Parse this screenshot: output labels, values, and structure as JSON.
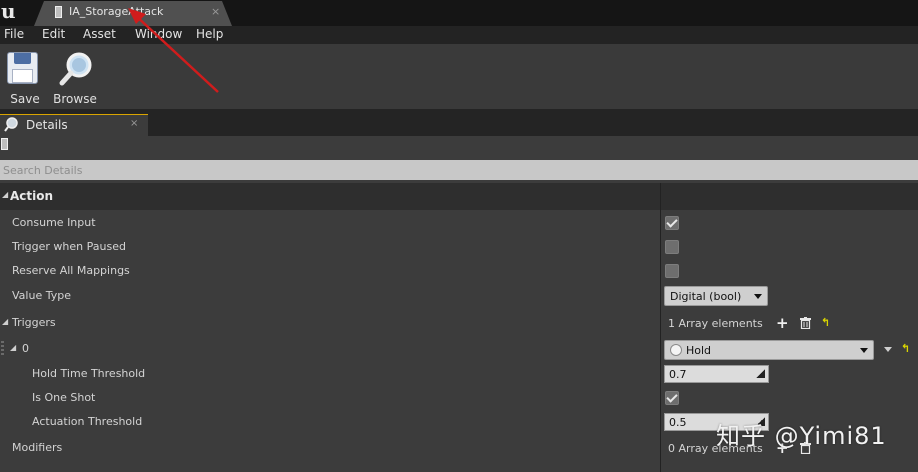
{
  "window": {
    "tab_title": "IA_StorageAttack",
    "tab_close": "×"
  },
  "menu": {
    "items": [
      "File",
      "Edit",
      "Asset",
      "Window",
      "Help"
    ]
  },
  "toolbar": {
    "save_label": "Save",
    "browse_label": "Browse"
  },
  "details_panel": {
    "tab_label": "Details",
    "tab_close": "×",
    "search_placeholder": "Search Details",
    "category": "Action",
    "properties": {
      "consume_input": {
        "label": "Consume Input",
        "checked": true
      },
      "trigger_when_paused": {
        "label": "Trigger when Paused",
        "checked": false
      },
      "reserve_all_mappings": {
        "label": "Reserve All Mappings",
        "checked": false
      },
      "value_type": {
        "label": "Value Type",
        "value": "Digital (bool)"
      },
      "triggers": {
        "label": "Triggers",
        "summary": "1 Array elements"
      },
      "trigger_0": {
        "label": "0",
        "value": "Hold"
      },
      "hold_time_threshold": {
        "label": "Hold Time Threshold",
        "value": "0.7"
      },
      "is_one_shot": {
        "label": "Is One Shot",
        "checked": true
      },
      "actuation_threshold": {
        "label": "Actuation Threshold",
        "value": "0.5"
      },
      "modifiers": {
        "label": "Modifiers",
        "summary": "0 Array elements"
      }
    }
  },
  "watermark": "知乎 @Yimi81",
  "colors": {
    "accent_tab_border": "#d9a400",
    "annotation_arrow": "#d01c1c",
    "reset_icon": "#d9d400"
  }
}
